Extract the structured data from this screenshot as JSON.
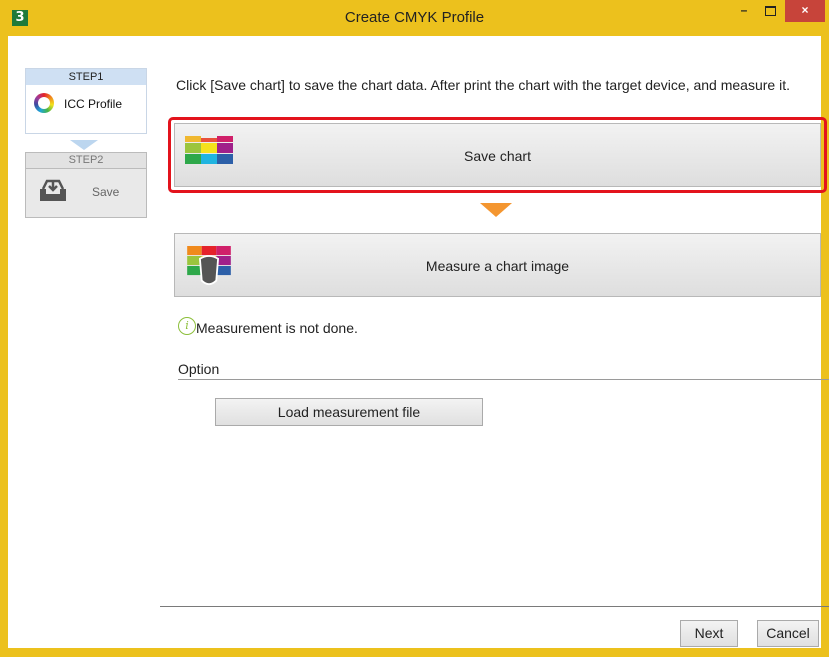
{
  "window": {
    "app_icon_text": "3",
    "title": "Create CMYK Profile",
    "minimize": "–",
    "close": "×"
  },
  "steps": [
    {
      "header": "STEP1",
      "label": "ICC Profile",
      "icon": "color-ring-icon",
      "active": true
    },
    {
      "header": "STEP2",
      "label": "Save",
      "icon": "save-tray-icon",
      "active": false
    }
  ],
  "main": {
    "instructions": "Click [Save chart] to save the chart data. After print the chart with the target device, and measure it.",
    "save_chart_label": "Save chart",
    "measure_label": "Measure a chart image",
    "status_text": "Measurement is not done.",
    "status_icon": "info-icon",
    "option_label": "Option",
    "load_button_label": "Load measurement file"
  },
  "footer": {
    "next_label": "Next",
    "cancel_label": "Cancel"
  },
  "colors": {
    "title_bar": "#ecc11d",
    "highlight": "#e3131c",
    "flow_arrow": "#f49630",
    "close_button": "#c7443a"
  }
}
